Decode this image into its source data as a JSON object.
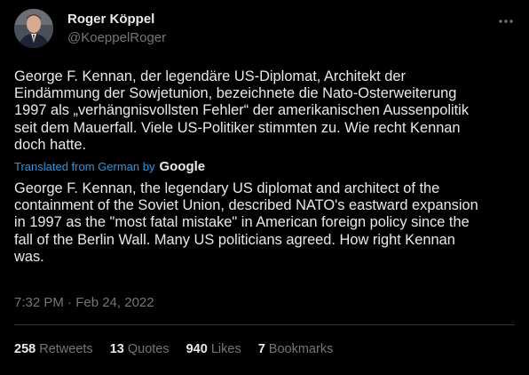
{
  "author": {
    "name": "Roger Köppel",
    "handle": "@KoeppelRoger"
  },
  "tweet": {
    "original_text": "George F. Kennan, der legendäre US-Diplomat, Architekt der\nEindämmung der Sowjetunion, bezeichnete die Nato-Osterweiterung\n1997 als „verhängnisvollsten Fehler“ der amerikanischen Aussenpolitik\nseit dem Mauerfall. Viele US-Politiker stimmten zu. Wie recht Kennan\ndoch hatte.",
    "translated_label": "Translated from German by",
    "translation_provider": "Google",
    "translation_text": "George F. Kennan, the legendary US diplomat and architect of the\ncontainment of the Soviet Union, described NATO's eastward expansion\nin 1997 as the \"most fatal mistake\" in American foreign policy since the\nfall of the Berlin Wall. Many US politicians agreed. How right Kennan\nwas.",
    "timestamp": "7:32 PM · Feb 24, 2022"
  },
  "stats": [
    {
      "count": "258",
      "label": "Retweets"
    },
    {
      "count": "13",
      "label": "Quotes"
    },
    {
      "count": "940",
      "label": "Likes"
    },
    {
      "count": "7",
      "label": "Bookmarks"
    }
  ],
  "icons": {
    "more": "more-horizontal-icon"
  },
  "colors": {
    "background": "#000000",
    "text_primary": "#e7e9ea",
    "text_secondary": "#71767b",
    "accent": "#1d9bf0",
    "divider": "#2f3336"
  }
}
